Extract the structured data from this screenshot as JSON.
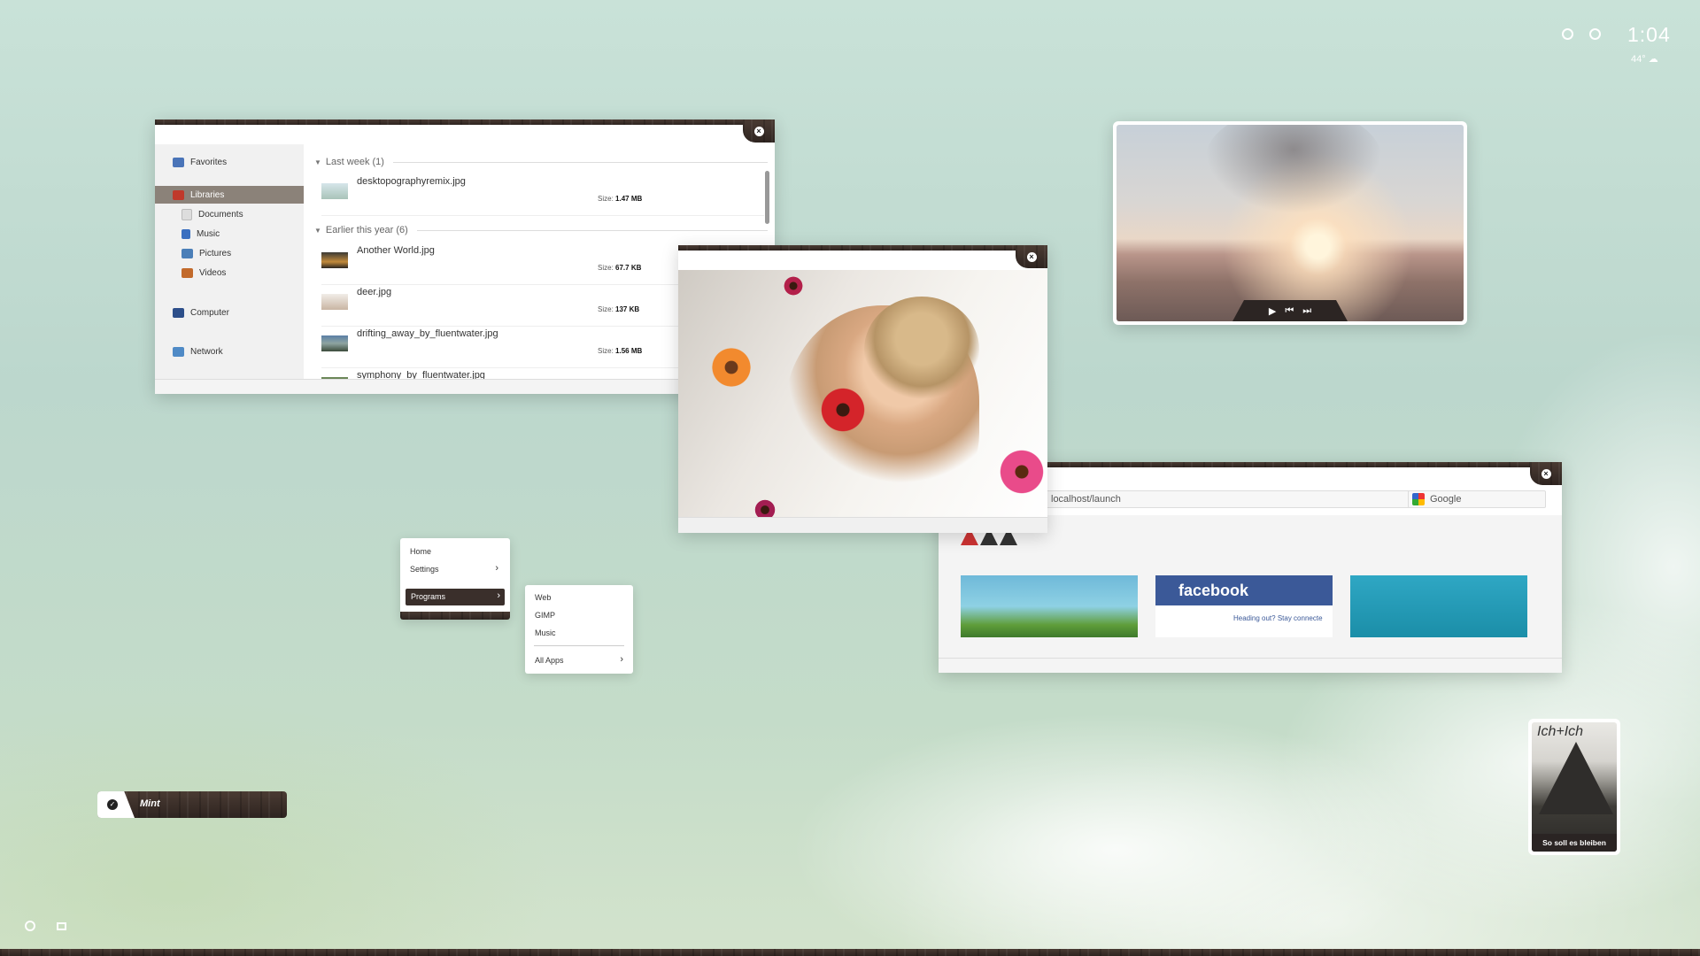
{
  "topbar": {
    "time": "1:04",
    "temperature": "44°",
    "icons": [
      "settings-icon",
      "clock-icon",
      "cloud-icon"
    ]
  },
  "explorer": {
    "sidebar": {
      "favorites": "Favorites",
      "libraries": "Libraries",
      "documents": "Documents",
      "music": "Music",
      "pictures": "Pictures",
      "videos": "Videos",
      "computer": "Computer",
      "network": "Network"
    },
    "groups": [
      {
        "title": "Last week (1)"
      },
      {
        "title": "Earlier this year (6)"
      }
    ],
    "files": [
      {
        "name": "desktopographyremix.jpg",
        "size_label": "Size:",
        "size": "1.47 MB"
      },
      {
        "name": "Another World.jpg",
        "size_label": "Size:",
        "size": "67.7 KB"
      },
      {
        "name": "deer.jpg",
        "size_label": "Size:",
        "size": "137 KB"
      },
      {
        "name": "drifting_away_by_fluentwater.jpg",
        "size_label": "Size:",
        "size": "1.56 MB"
      },
      {
        "name": "symphony_by_fluentwater.jpg"
      }
    ]
  },
  "browser": {
    "url": "localhost/launch",
    "search_placeholder": "Google",
    "tiles": {
      "facebook": "facebook",
      "facebook_sub": "Heading out? Stay connecte"
    }
  },
  "menu1": {
    "home": "Home",
    "settings": "Settings",
    "programs": "Programs"
  },
  "menu2": {
    "web": "Web",
    "gimp": "GIMP",
    "music": "Music",
    "all_apps": "All Apps"
  },
  "mint": {
    "label": "Mint"
  },
  "album": {
    "title": "So soll es bleiben",
    "scrawl": "Ich+Ich"
  },
  "colors": {
    "wood": "#3a2f2b",
    "selected": "#8b8279",
    "facebook": "#3b5998"
  }
}
